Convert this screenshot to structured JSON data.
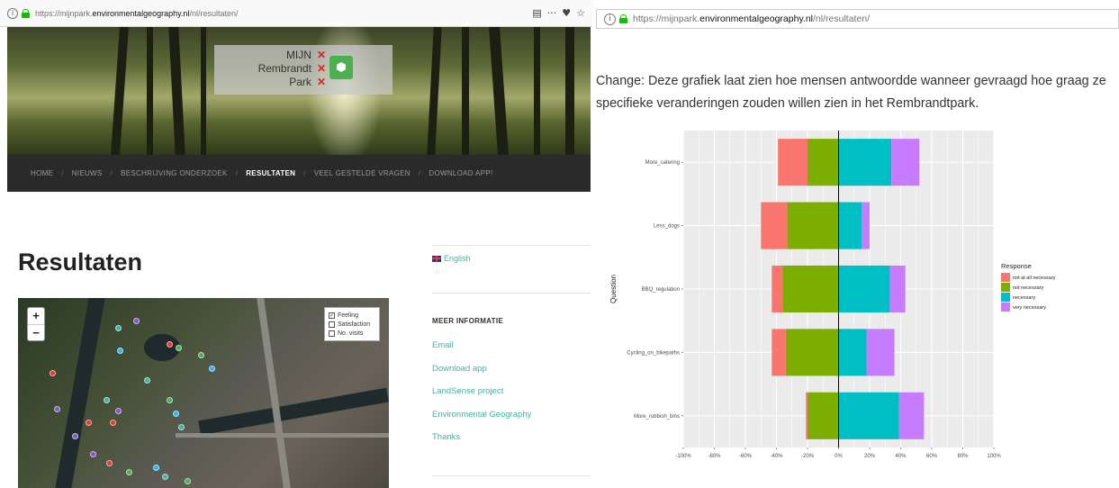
{
  "left_browser": {
    "url_prefix": "https://mijnpark.",
    "url_domain": "environmentalgeography.nl",
    "url_path": "/nl/resultaten/",
    "tool_icons": [
      "reader-view-icon",
      "more-icon",
      "pocket-icon",
      "bookmark-star-icon"
    ],
    "tool_glyphs": [
      "▤",
      "···",
      "♥",
      "☆"
    ]
  },
  "logo": {
    "line1": "MIJN",
    "line2": "Rembrandt",
    "line3": "Park",
    "x_mark": "✕"
  },
  "nav": {
    "items": [
      {
        "label": "HOME",
        "active": false
      },
      {
        "label": "NIEUWS",
        "active": false
      },
      {
        "label": "BESCHRIJVING ONDERZOEK",
        "active": false
      },
      {
        "label": "RESULTATEN",
        "active": true
      },
      {
        "label": "VEEL GESTELDE VRAGEN",
        "active": false
      },
      {
        "label": "DOWNLOAD APP!",
        "active": false
      }
    ],
    "separator": "/"
  },
  "page": {
    "title": "Resultaten"
  },
  "map": {
    "zoom_in": "+",
    "zoom_out": "−",
    "layers": [
      {
        "label": "Feeling",
        "checked": true
      },
      {
        "label": "Satisfaction",
        "checked": false
      },
      {
        "label": "No. visits",
        "checked": false
      }
    ]
  },
  "sidebar": {
    "language": "English",
    "heading": "MEER INFORMATIE",
    "links": [
      "Email",
      "Download app",
      "LandSense project",
      "Environmental Geography",
      "Thanks"
    ]
  },
  "right_browser": {
    "url_prefix": "https://mijnpark.",
    "url_domain": "environmentalgeography.nl",
    "url_path": "/nl/resultaten/"
  },
  "chart_intro": "Change: Deze grafiek laat zien hoe mensen antwoordde wanneer gevraagd hoe graag ze specifieke veranderingen zouden willen zien in het Rembrandtpark.",
  "chart_data": {
    "type": "bar",
    "orientation": "horizontal-diverging-stacked",
    "ylabel": "Question",
    "xlim": [
      -100,
      100
    ],
    "x_ticks": [
      "-100%",
      "-80%",
      "-60%",
      "-40%",
      "-20%",
      "0%",
      "20%",
      "40%",
      "60%",
      "80%",
      "100%"
    ],
    "legend_title": "Response",
    "legend_position": "right",
    "grid": true,
    "categories": [
      "More_catering",
      "Less_dogs",
      "BBQ_regulation",
      "Cycling_on_bikepaths",
      "More_rubbish_bins"
    ],
    "series": [
      {
        "name": "not at all necessary",
        "color": "#F8766D",
        "values": [
          -19,
          -17,
          -7,
          -9,
          -1
        ]
      },
      {
        "name": "not necessary",
        "color": "#7CAE00",
        "values": [
          -20,
          -33,
          -36,
          -34,
          -20
        ]
      },
      {
        "name": "necessary",
        "color": "#00BFC4",
        "values": [
          34,
          15,
          33,
          18,
          39
        ]
      },
      {
        "name": "very necessary",
        "color": "#C77CFF",
        "values": [
          18,
          5,
          10,
          18,
          16
        ]
      }
    ]
  }
}
